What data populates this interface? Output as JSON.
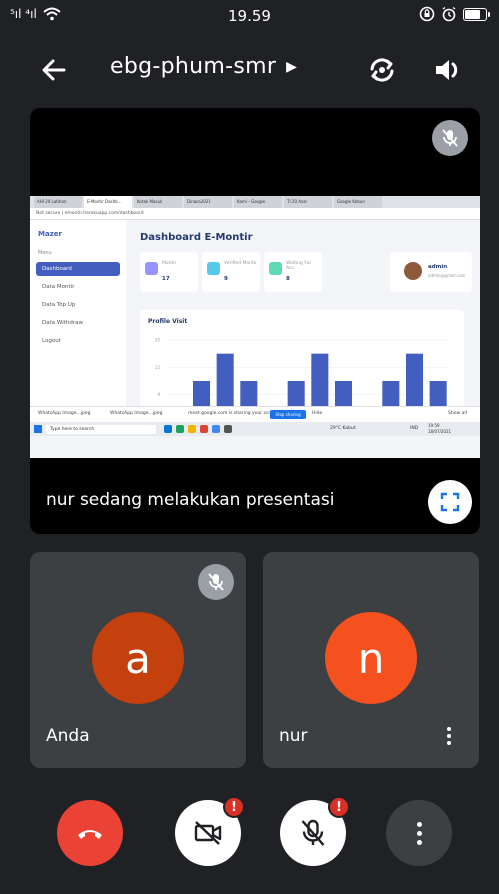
{
  "status": {
    "signal": "⁵ıl ⁴ıl",
    "time": "19.59"
  },
  "meeting": {
    "title": "ebg-phum-smr"
  },
  "presentation": {
    "label": "nur sedang melakukan presentasi"
  },
  "shared_screen": {
    "tabs": [
      "AHI 20 Latihan",
      "E-Montir Dashb...",
      "Kotak Masuk",
      "Dinasa2021",
      "Kami - Google",
      "TI 20 Asal",
      "Google Kebun"
    ],
    "url": "Not secure | emontir.herokuapp.com/dashboard",
    "brand": "Mazer",
    "menu_label": "Menu",
    "menu": [
      {
        "label": "Dashboard"
      },
      {
        "label": "Data Montir"
      },
      {
        "label": "Data Top Up"
      },
      {
        "label": "Data Withdraw"
      },
      {
        "label": "Logout"
      }
    ],
    "dashboard_title": "Dashboard E-Montir",
    "stats": [
      {
        "label": "Montir",
        "value": "17",
        "color": "#9694ff"
      },
      {
        "label": "Verified Montir",
        "value": "9",
        "color": "#57caeb"
      },
      {
        "label": "Waiting For Acc",
        "value": "8",
        "color": "#5ddab4"
      }
    ],
    "admin": {
      "name": "admin",
      "email": "admin@gmail.com"
    },
    "chart_title": "Profile Visit",
    "chart_data": {
      "type": "bar",
      "values": [
        3,
        9,
        15,
        9,
        3,
        9,
        15,
        9,
        3,
        9,
        15,
        9
      ],
      "ylim": [
        0,
        18
      ],
      "yticks": [
        "20",
        "15",
        "9",
        "0"
      ],
      "color": "#435ebe"
    },
    "downloads": [
      "WhatsApp Image...jpeg",
      "WhatsApp Image...jpeg"
    ],
    "share_notice": "meet.google.com is sharing your screen",
    "share_btn": "Stop sharing",
    "hide_btn": "Hide",
    "show_all": "Show all",
    "taskbar_search": "Type here to search",
    "taskbar_weather": "29°C Kabut",
    "taskbar_lang": "IND",
    "taskbar_time": "19:59",
    "taskbar_date": "18/07/2021"
  },
  "participants": [
    {
      "initial": "a",
      "name": "Anda",
      "color": "#c4400d"
    },
    {
      "initial": "n",
      "name": "nur",
      "color": "#f4511e"
    }
  ],
  "controls": {
    "alert_glyph": "!",
    "end_call_color": "#ea4335"
  }
}
